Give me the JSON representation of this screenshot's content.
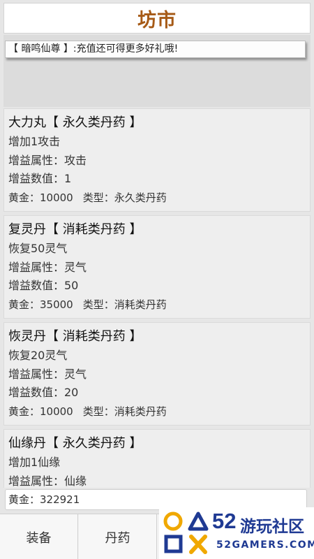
{
  "header": {
    "title": "坊市"
  },
  "notice": {
    "text": "【 暗鸣仙尊 】:充值还可得更多好礼哦!"
  },
  "items": [
    {
      "name": "大力丸【 永久类丹药 】",
      "desc": "增加1攻击",
      "attr": "增益属性：攻击",
      "value": "增益数值：1",
      "gold": "黄金：10000",
      "type": "类型：永久类丹药"
    },
    {
      "name": "复灵丹【 消耗类丹药 】",
      "desc": "恢复50灵气",
      "attr": "增益属性：灵气",
      "value": "增益数值：50",
      "gold": "黄金：35000",
      "type": "类型：消耗类丹药"
    },
    {
      "name": "恢灵丹【 消耗类丹药 】",
      "desc": "恢复20灵气",
      "attr": "增益属性：灵气",
      "value": "增益数值：20",
      "gold": "黄金：10000",
      "type": "类型：消耗类丹药"
    },
    {
      "name": "仙缘丹【 永久类丹药 】",
      "desc": "增加1仙缘",
      "attr": "增益属性：仙缘",
      "value": "",
      "gold": "",
      "type": ""
    }
  ],
  "footer": {
    "gold_balance": "黄金：322921"
  },
  "tabs": [
    {
      "label": "装备"
    },
    {
      "label": "丹药"
    }
  ],
  "watermark": {
    "number": "52",
    "name_cn": "游玩社区",
    "name_en": "52GAMERS.COM"
  },
  "colors": {
    "title": "#a65a16",
    "watermark": "#1f3a93",
    "background": "#e6e6e6"
  }
}
